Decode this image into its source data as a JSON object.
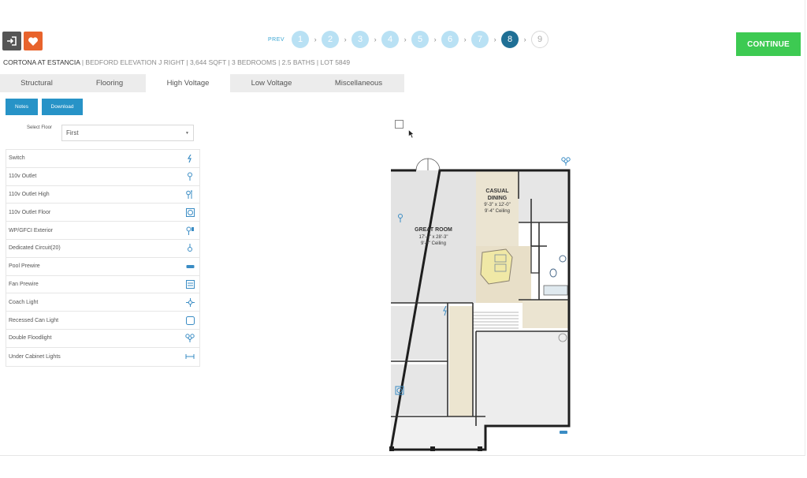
{
  "header": {
    "login_icon": "sign-in-icon",
    "favorite_icon": "heart-icon",
    "prev_label": "PREV",
    "steps": [
      "1",
      "2",
      "3",
      "4",
      "5",
      "6",
      "7",
      "8",
      "9"
    ],
    "active_step": "8",
    "continue_label": "CONTINUE"
  },
  "home": {
    "name": "CORTONA AT ESTANCIA",
    "details": " | BEDFORD ELEVATION J RIGHT | 3,644 SQFT | 3 BEDROOMS | 2.5 BATHS | LOT 5849"
  },
  "tabs": [
    "Structural",
    "Flooring",
    "High Voltage",
    "Low Voltage",
    "Miscellaneous"
  ],
  "active_tab": "High Voltage",
  "toolbar": {
    "notes_label": "Notes",
    "download_label": "Download"
  },
  "floor_select": {
    "label": "Select Floor",
    "value": "First"
  },
  "legend": [
    {
      "label": "Switch",
      "icon": "switch-icon"
    },
    {
      "label": "110v Outlet",
      "icon": "outlet-icon"
    },
    {
      "label": "110v Outlet High",
      "icon": "outlet-high-icon"
    },
    {
      "label": "110v Outlet Floor",
      "icon": "outlet-floor-icon"
    },
    {
      "label": "WP/GFCI Exterior",
      "icon": "gfci-exterior-icon"
    },
    {
      "label": "Dedicated Circuit(20)",
      "icon": "dedicated-circuit-icon"
    },
    {
      "label": "Pool Prewire",
      "icon": "pool-prewire-icon"
    },
    {
      "label": "Fan Prewire",
      "icon": "fan-prewire-icon"
    },
    {
      "label": "Coach Light",
      "icon": "coach-light-icon"
    },
    {
      "label": "Recessed Can Light",
      "icon": "recessed-light-icon"
    },
    {
      "label": "Double Floodlight",
      "icon": "double-floodlight-icon"
    },
    {
      "label": "Under Cabinet Lights",
      "icon": "under-cabinet-light-icon"
    }
  ],
  "floorplan": {
    "great_room": {
      "name": "GREAT ROOM",
      "size": "17'-4\" x 28'-3\"",
      "ceiling": "9'-4\" Ceiling"
    },
    "casual_dining": {
      "name1": "CASUAL",
      "name2": "DINING",
      "size": "9'-3\" x 12'-0\"",
      "ceiling": "9'-4\" Ceiling"
    }
  },
  "colors": {
    "accent_blue": "#2793c7",
    "step_light": "#b9e1f4",
    "step_active": "#1f6f95",
    "continue_green": "#3dca52",
    "favorite_orange": "#e8632c",
    "symbol_blue": "#3a8cc4"
  }
}
